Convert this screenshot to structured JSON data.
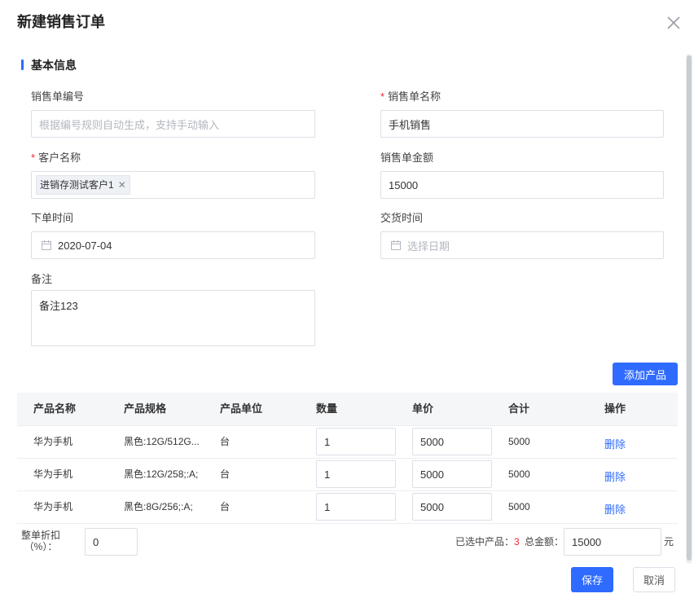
{
  "dialog": {
    "title": "新建销售订单"
  },
  "section": {
    "title": "基本信息"
  },
  "form": {
    "order_no_label": "销售单编号",
    "order_no_placeholder": "根据编号规则自动生成，支持手动输入",
    "order_name_label": "销售单名称",
    "order_name_value": "手机销售",
    "customer_label": "客户名称",
    "customer_tag": "进销存测试客户1",
    "amount_label": "销售单金额",
    "amount_value": "15000",
    "order_time_label": "下单时间",
    "order_time_value": "2020-07-04",
    "delivery_time_label": "交货时间",
    "delivery_time_placeholder": "选择日期",
    "remark_label": "备注",
    "remark_value": "备注123",
    "required_mark": "*"
  },
  "products": {
    "add_button": "添加产品",
    "columns": [
      "产品名称",
      "产品规格",
      "产品单位",
      "数量",
      "单价",
      "合计",
      "操作"
    ],
    "rows": [
      {
        "name": "华为手机",
        "spec": "黑色:12G/512G...",
        "unit": "台",
        "qty": "1",
        "price": "5000",
        "total": "5000",
        "action": "删除"
      },
      {
        "name": "华为手机",
        "spec": "黑色:12G/258;:A;",
        "unit": "台",
        "qty": "1",
        "price": "5000",
        "total": "5000",
        "action": "删除"
      },
      {
        "name": "华为手机",
        "spec": "黑色:8G/256;:A;",
        "unit": "台",
        "qty": "1",
        "price": "5000",
        "total": "5000",
        "action": "删除"
      }
    ]
  },
  "summary": {
    "discount_label_line1": "整单折扣",
    "discount_label_line2": "（%）：",
    "discount_value": "0",
    "selected_label": "已选中产品：",
    "selected_count": "3",
    "total_label": "总金额：",
    "total_value": "15000",
    "currency": "元"
  },
  "footer": {
    "save": "保存",
    "cancel": "取消"
  },
  "colors": {
    "primary": "#2f6bff",
    "required": "#f5222d",
    "count": "#f5222d"
  },
  "icons": {
    "close": "close-icon",
    "calendar": "calendar-icon",
    "tag_close": "tag-close-icon"
  }
}
